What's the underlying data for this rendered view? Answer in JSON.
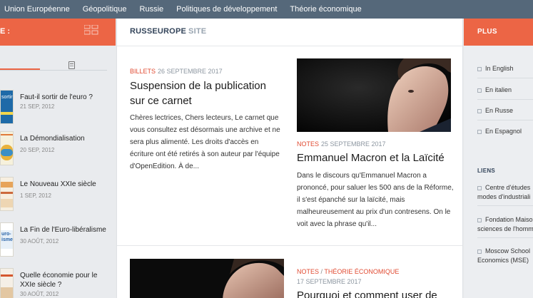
{
  "topnav": {
    "items": [
      "Union Européenne",
      "Géopolitique",
      "Russie",
      "Politiques de développement",
      "Théorie économique"
    ]
  },
  "left": {
    "header_label": "E :",
    "items": [
      {
        "title": "Faut-il sortir de l'euro ?",
        "date": "21 SEP, 2012",
        "thumb_text": "sortir"
      },
      {
        "title": "La Démondialisation",
        "date": "20 SEP, 2012",
        "thumb_text": ""
      },
      {
        "title": "Le Nouveau XXIe siècle",
        "date": "1 SEP, 2012",
        "thumb_text": ""
      },
      {
        "title": "La Fin de l'Euro-libéralisme",
        "date": "30 AOÛT, 2012",
        "thumb_text": "Euro-\nlisme"
      },
      {
        "title": "Quelle économie pour le XXIe siècle ?",
        "date": "30 AOÛT, 2012",
        "thumb_text": ""
      }
    ]
  },
  "site": {
    "main": "RUSSEUROPE",
    "sub": "SITE"
  },
  "posts": [
    {
      "category": "BILLETS",
      "date": "26 SEPTEMBRE 2017",
      "title": "Suspension de la publication sur ce carnet",
      "excerpt": "Chères lectrices, Chers lecteurs, Le carnet que vous consultez est désormais une archive et ne sera plus alimenté. Les droits d'accès en écriture ont été retirés à son auteur par l'équipe d'OpenEdition. À de..."
    },
    {
      "category": "NOTES",
      "date": "25 SEPTEMBRE 2017",
      "title": "Emmanuel Macron et la Laïcité",
      "excerpt": "Dans le discours qu'Emmanuel Macron a prononcé, pour saluer les 500 ans de la Réforme, il s'est épanché sur la laïcité, mais malheureusement au prix d'un contresens. On le voit avec la phrase qu'il..."
    },
    {
      "category": "NOTES",
      "category2": "THÉORIE ÉCONOMIQUE",
      "separator": "/",
      "date": "17 SEPTEMBRE 2017",
      "title": "Pourquoi et comment user de"
    }
  ],
  "right": {
    "header_label": "PLUS",
    "lang_links": [
      "In English",
      "En italien",
      "En Russe",
      "En Espagnol"
    ],
    "liens_label": "LIENS",
    "liens": [
      "Centre d'études modes d'industriali",
      "Fondation Maiso sciences de l'homm",
      "Moscow School Economics (MSE)"
    ]
  },
  "colors": {
    "accent": "#ec6545",
    "nav": "#55687a",
    "category": "#e14b32"
  }
}
